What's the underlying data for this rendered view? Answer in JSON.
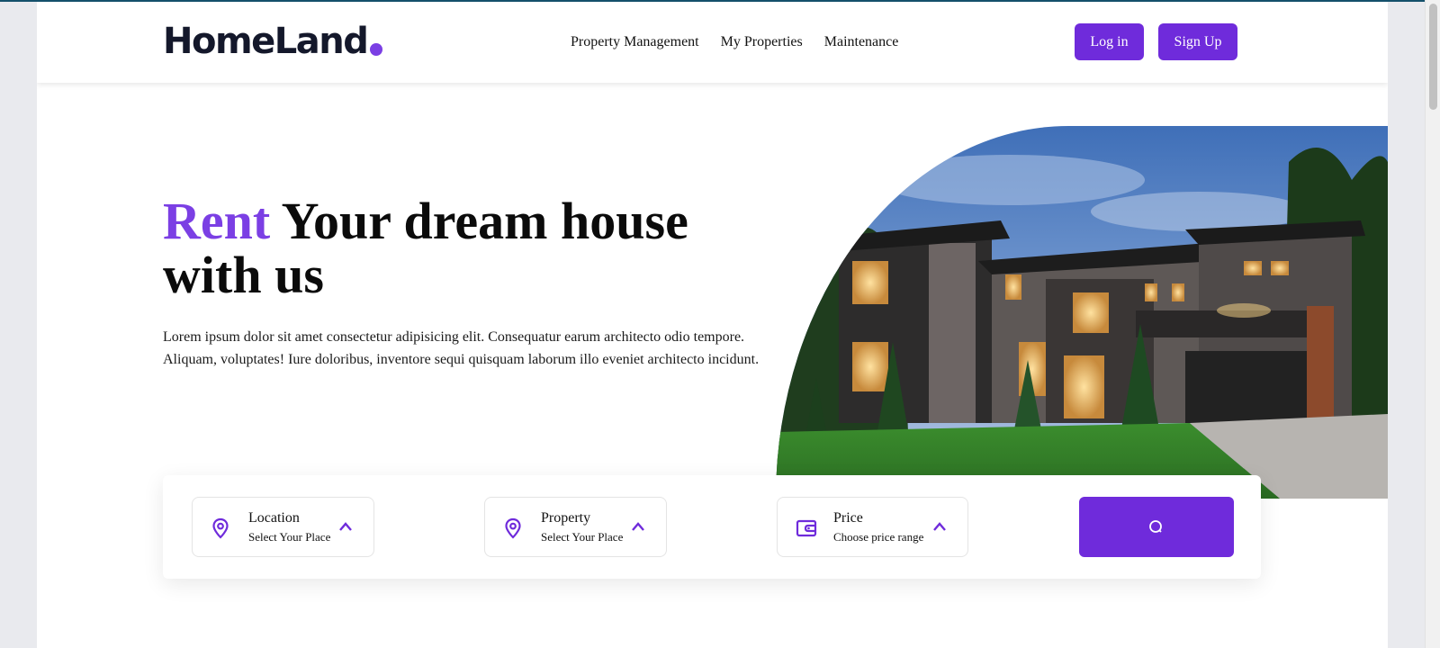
{
  "brand": {
    "name": "HomeLand",
    "accent_color": "#7b3fe4"
  },
  "nav": {
    "items": [
      {
        "label": "Property Management"
      },
      {
        "label": "My Properties"
      },
      {
        "label": "Maintenance"
      }
    ]
  },
  "auth": {
    "login_label": "Log in",
    "signup_label": "Sign Up",
    "button_color": "#6f2bdb"
  },
  "hero": {
    "title_accent": "Rent",
    "title_rest": "Your dream house with us",
    "description": "Lorem ipsum dolor sit amet consectetur adipisicing elit. Consequatur earum architecto odio tempore. Aliquam, voluptates! Iure doloribus, inventore sequi quisquam laborum illo eveniet architecto incidunt.",
    "image_subject": "modern house at dusk"
  },
  "search": {
    "fields": [
      {
        "title": "Location",
        "subtitle": "Select Your Place",
        "icon": "map-pin-icon"
      },
      {
        "title": "Property",
        "subtitle": "Select Your Place",
        "icon": "map-pin-icon"
      },
      {
        "title": "Price",
        "subtitle": "Choose price range",
        "icon": "wallet-icon"
      }
    ],
    "button_icon": "search-icon"
  }
}
